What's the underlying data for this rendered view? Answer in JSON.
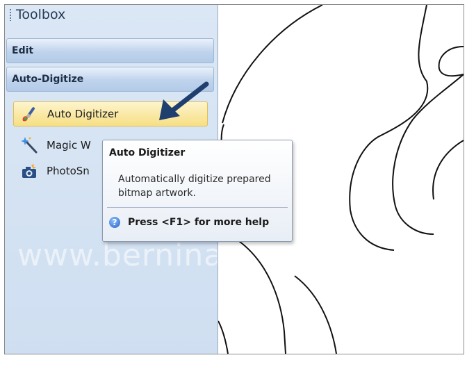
{
  "toolbox": {
    "title": "Toolbox",
    "sections": [
      {
        "label": "Edit"
      },
      {
        "label": "Auto-Digitize"
      }
    ],
    "tools": [
      {
        "label": "Auto Digitizer",
        "icon": "paintbrush-icon",
        "selected": true
      },
      {
        "label": "Magic W",
        "icon": "magic-wand-icon",
        "selected": false
      },
      {
        "label": "PhotoSn",
        "icon": "camera-icon",
        "selected": false
      }
    ]
  },
  "tooltip": {
    "title": "Auto Digitizer",
    "description": "Automatically digitize prepared bitmap artwork.",
    "help": "Press <F1> for more help"
  },
  "watermark": "www.bernina",
  "colors": {
    "toolbox_bg": "#d5e3f3",
    "selected_tool": "#f6df84",
    "annotation_arrow": "#1f3f6e"
  }
}
